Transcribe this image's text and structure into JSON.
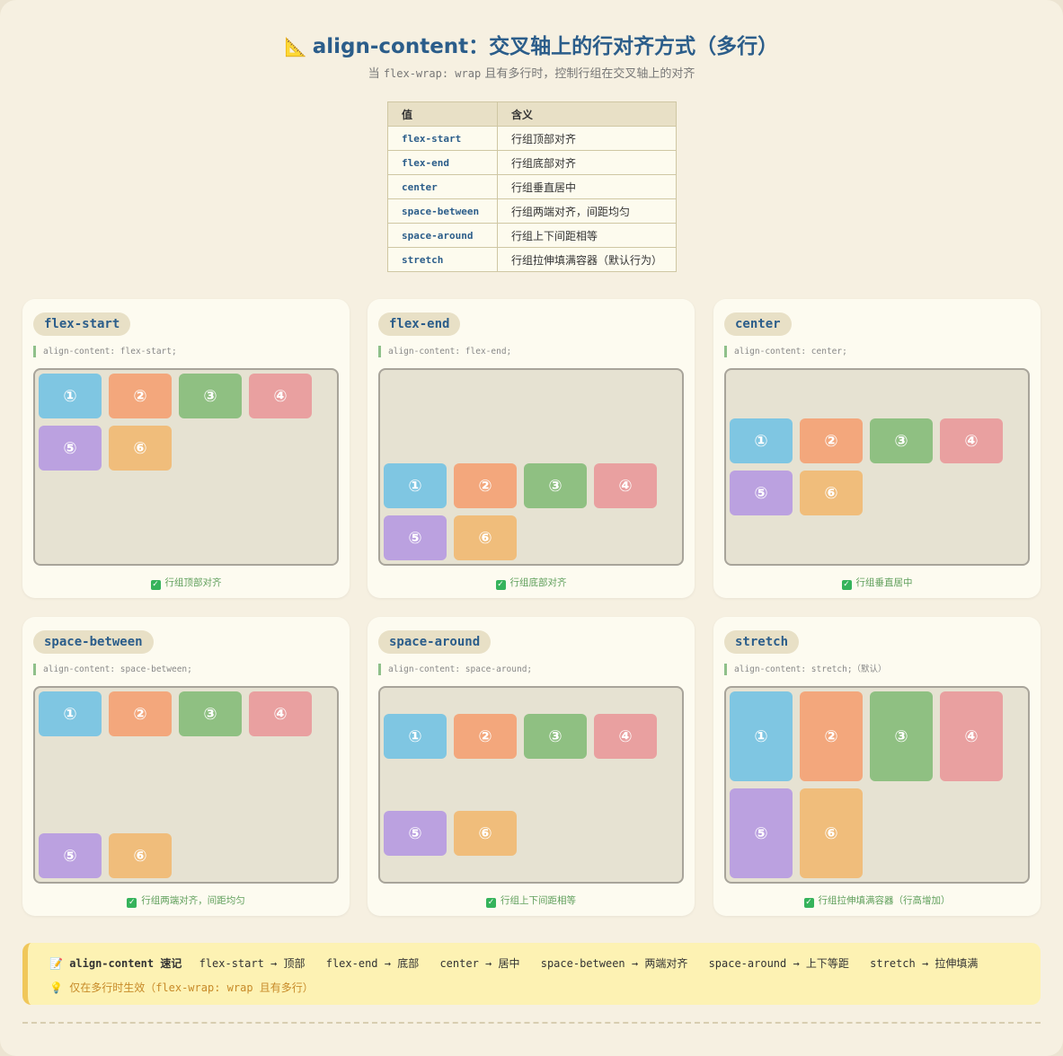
{
  "header": {
    "icon": "📐",
    "title": "align-content：交叉轴上的行对齐方式（多行）",
    "subtitle_pre": "当 ",
    "subtitle_code": "flex-wrap: wrap",
    "subtitle_post": " 且有多行时，控制行组在交叉轴上的对齐"
  },
  "table": {
    "headers": [
      "值",
      "含义"
    ],
    "rows": [
      {
        "value": "flex-start",
        "meaning": "行组顶部对齐"
      },
      {
        "value": "flex-end",
        "meaning": "行组底部对齐"
      },
      {
        "value": "center",
        "meaning": "行组垂直居中"
      },
      {
        "value": "space-between",
        "meaning": "行组两端对齐，间距均匀"
      },
      {
        "value": "space-around",
        "meaning": "行组上下间距相等"
      },
      {
        "value": "stretch",
        "meaning": "行组拉伸填满容器（默认行为）"
      }
    ]
  },
  "items": [
    "①",
    "②",
    "③",
    "④",
    "⑤",
    "⑥"
  ],
  "colors": {
    "item1": "#7fc6e2",
    "item2": "#f3a77c",
    "item3": "#8fc082",
    "item4": "#e9a0a0",
    "item5": "#bba1e0",
    "item6": "#f0bd7b",
    "accent": "#2b5d8a"
  },
  "cards": [
    {
      "tag": "flex-start",
      "code": "align-content: flex-start;",
      "note": "行组顶部对齐"
    },
    {
      "tag": "flex-end",
      "code": "align-content: flex-end;",
      "note": "行组底部对齐"
    },
    {
      "tag": "center",
      "code": "align-content: center;",
      "note": "行组垂直居中"
    },
    {
      "tag": "space-between",
      "code": "align-content: space-between;",
      "note": "行组两端对齐，间距均匀"
    },
    {
      "tag": "space-around",
      "code": "align-content: space-around;",
      "note": "行组上下间距相等"
    },
    {
      "tag": "stretch",
      "code": "align-content: stretch;（默认）",
      "note": "行组拉伸填满容器（行高增加）"
    }
  ],
  "check_icon": "✓",
  "memo": {
    "icon": "📝",
    "head": "align-content 速记",
    "pairs": [
      "flex-start → 顶部",
      "flex-end → 底部",
      "center → 居中",
      "space-between → 两端对齐",
      "space-around → 上下等距",
      "stretch → 拉伸填满"
    ],
    "tip_icon": "💡",
    "tip": "仅在多行时生效（flex-wrap: wrap 且有多行）"
  }
}
